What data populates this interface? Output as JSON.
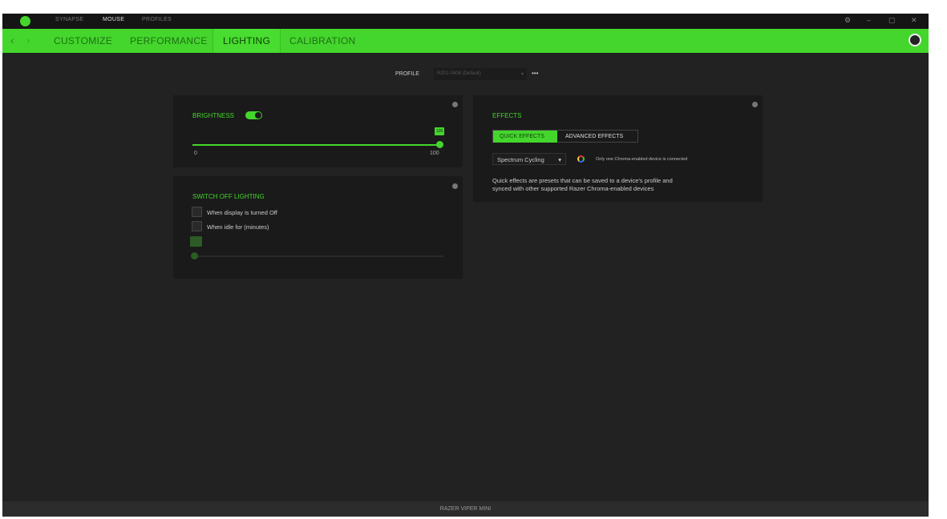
{
  "topbar": {
    "tabs": [
      "SYNAPSE",
      "MOUSE",
      "PROFILES"
    ],
    "active": "MOUSE"
  },
  "nav": {
    "tabs": [
      "CUSTOMIZE",
      "PERFORMANCE",
      "LIGHTING",
      "CALIBRATION"
    ],
    "active": "LIGHTING"
  },
  "profile": {
    "label": "PROFILE",
    "value": "RZ01-0408 (Default)",
    "more": "•••"
  },
  "brightness": {
    "title": "BRIGHTNESS",
    "enabled": true,
    "value": "100",
    "min": "0",
    "max": "100",
    "percent": 100
  },
  "switch_off": {
    "title": "SWITCH OFF LIGHTING",
    "option1": "When display is turned Off",
    "option2": "When idle for (minutes)",
    "option1_checked": false,
    "option2_checked": false
  },
  "effects": {
    "title": "EFFECTS",
    "quick": "QUICK EFFECTS",
    "advanced": "ADVANCED EFFECTS",
    "selected_effect": "Spectrum Cycling",
    "note": "Only one Chroma-enabled device is connected",
    "description_line1": "Quick effects are presets that can be saved to a device's profile and",
    "description_line2": "synced with other supported Razer Chroma-enabled devices"
  },
  "footer": {
    "device": "RAZER VIPER MINI"
  },
  "colors": {
    "accent": "#44d62c"
  }
}
